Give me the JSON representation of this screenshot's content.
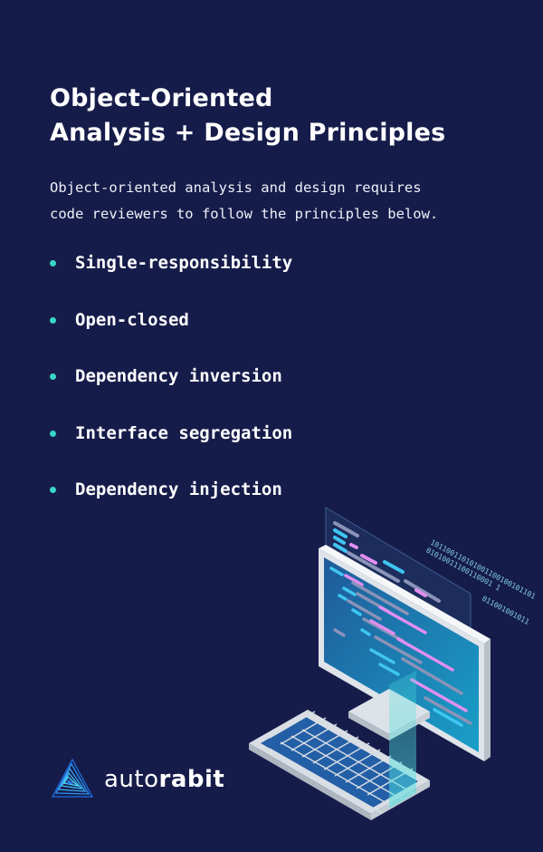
{
  "header": {
    "title_line1": "Object-Oriented",
    "title_line2": "Analysis + Design Principles"
  },
  "intro": {
    "line1": "Object-oriented analysis and design requires",
    "line2": "code reviewers to follow the principles below."
  },
  "principles": [
    {
      "label": "Single-responsibility"
    },
    {
      "label": "Open-closed"
    },
    {
      "label": "Dependency inversion"
    },
    {
      "label": "Interface segregation"
    },
    {
      "label": "Dependency injection"
    }
  ],
  "illustration": {
    "icon": "computer-code-icon",
    "binary_line1": "101100110101001100100101101",
    "binary_line2": "01010011100110001 1",
    "binary_line3": "011001001011"
  },
  "brand": {
    "logo_icon": "autorabit-logo-icon",
    "name_light": "auto",
    "name_bold": "rabit"
  },
  "colors": {
    "background": "#161c4a",
    "accent": "#3ad6c6",
    "text": "#ffffff"
  }
}
